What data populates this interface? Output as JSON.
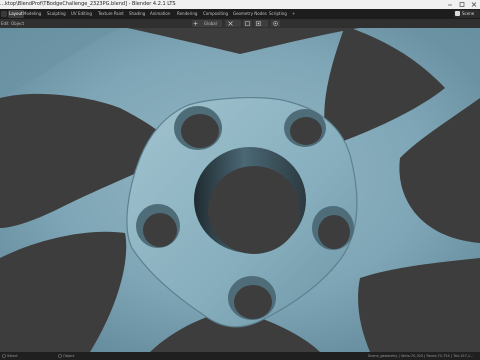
{
  "window": {
    "title": "…ktop\\BlendProf\\TBodgeChallenge_2323PG.blend] - Blender 4.2.1 LTS"
  },
  "workspaces": {
    "tabs": [
      "Layout",
      "Modeling",
      "Sculpting",
      "UV Editing",
      "Texture Paint",
      "Shading",
      "Animation",
      "Rendering",
      "Compositing",
      "Geometry Nodes",
      "Scripting"
    ],
    "active": "Layout",
    "add": "+",
    "scene": "Scene"
  },
  "header": {
    "menu_edit": "Edit",
    "menu_object": "Object",
    "orientation": "Global"
  },
  "statusbar": {
    "left_hint": "Select",
    "mid_hint": "Object",
    "stats": "Scene_geometry | Verts:70,320 | Faces:70,754 | Tris:157,1..."
  },
  "colors": {
    "metal": "#7ea4b4",
    "holes": "#3d3d3d",
    "titlebar": "#f0f0f0",
    "topbar": "#1d1d1d",
    "header": "#303030"
  }
}
